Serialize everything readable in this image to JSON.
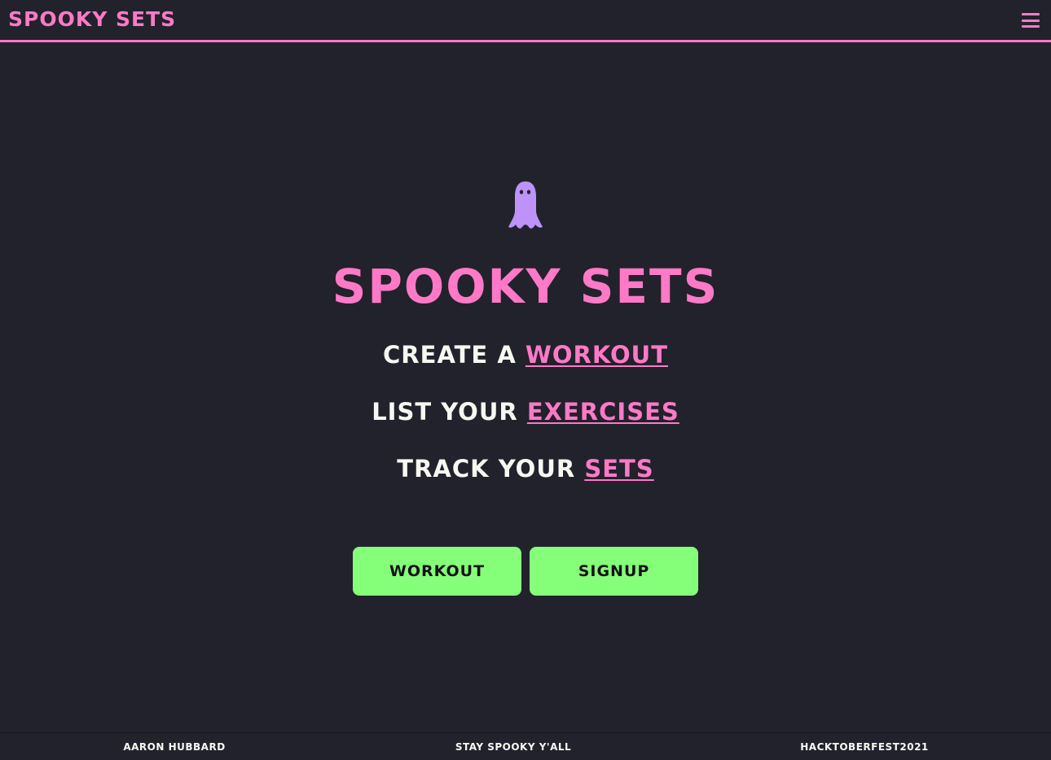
{
  "navbar": {
    "brand": "SPOOKY SETS",
    "menu_icon": "hamburger-menu-icon"
  },
  "hero": {
    "icon": "ghost-icon",
    "title": "SPOOKY SETS",
    "taglines": [
      {
        "prefix": "CREATE A ",
        "link": "WORKOUT"
      },
      {
        "prefix": "LIST YOUR ",
        "link": "EXERCISES"
      },
      {
        "prefix": "TRACK YOUR ",
        "link": "SETS"
      }
    ],
    "buttons": {
      "workout": "WORKOUT",
      "signup": "SIGNUP"
    }
  },
  "footer": {
    "left": "AARON HUBBARD",
    "center": "STAY SPOOKY Y'ALL",
    "right": "HACKTOBERFEST2021"
  },
  "colors": {
    "background": "#21222c",
    "accent_pink": "#ff79c6",
    "ghost_purple": "#bd93f9",
    "button_green": "#85ff7a",
    "text_light": "#f8f8f2"
  }
}
